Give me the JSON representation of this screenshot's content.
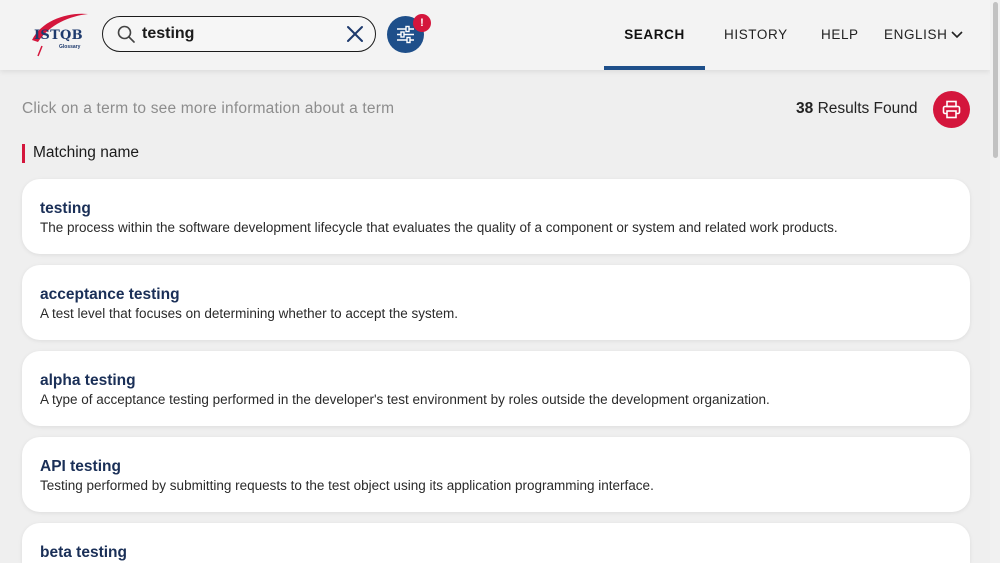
{
  "header": {
    "logo": {
      "text": "ISTQB",
      "subtext": "Glossary"
    },
    "search": {
      "value": "testing",
      "placeholder": ""
    },
    "filter_badge": "!",
    "nav": {
      "search": "SEARCH",
      "history": "HISTORY",
      "help": "HELP",
      "language": "ENGLISH"
    }
  },
  "info": {
    "hint": "Click on a term to see more information about a term",
    "results_count": "38",
    "results_label": "Results Found"
  },
  "section": {
    "title": "Matching name"
  },
  "terms": [
    {
      "name": "testing",
      "definition": "The process within the software development lifecycle that evaluates the quality of a component or system and related work products."
    },
    {
      "name": "acceptance testing",
      "definition": "A test level that focuses on determining whether to accept the system."
    },
    {
      "name": "alpha testing",
      "definition": "A type of acceptance testing performed in the developer's test environment by roles outside the development organization."
    },
    {
      "name": "API testing",
      "definition": "Testing performed by submitting requests to the test object using its application programming interface."
    },
    {
      "name": "beta testing",
      "definition": ""
    }
  ],
  "colors": {
    "brand_blue": "#1e4f8a",
    "accent_red": "#d4163c",
    "term_title": "#1a2f57"
  }
}
